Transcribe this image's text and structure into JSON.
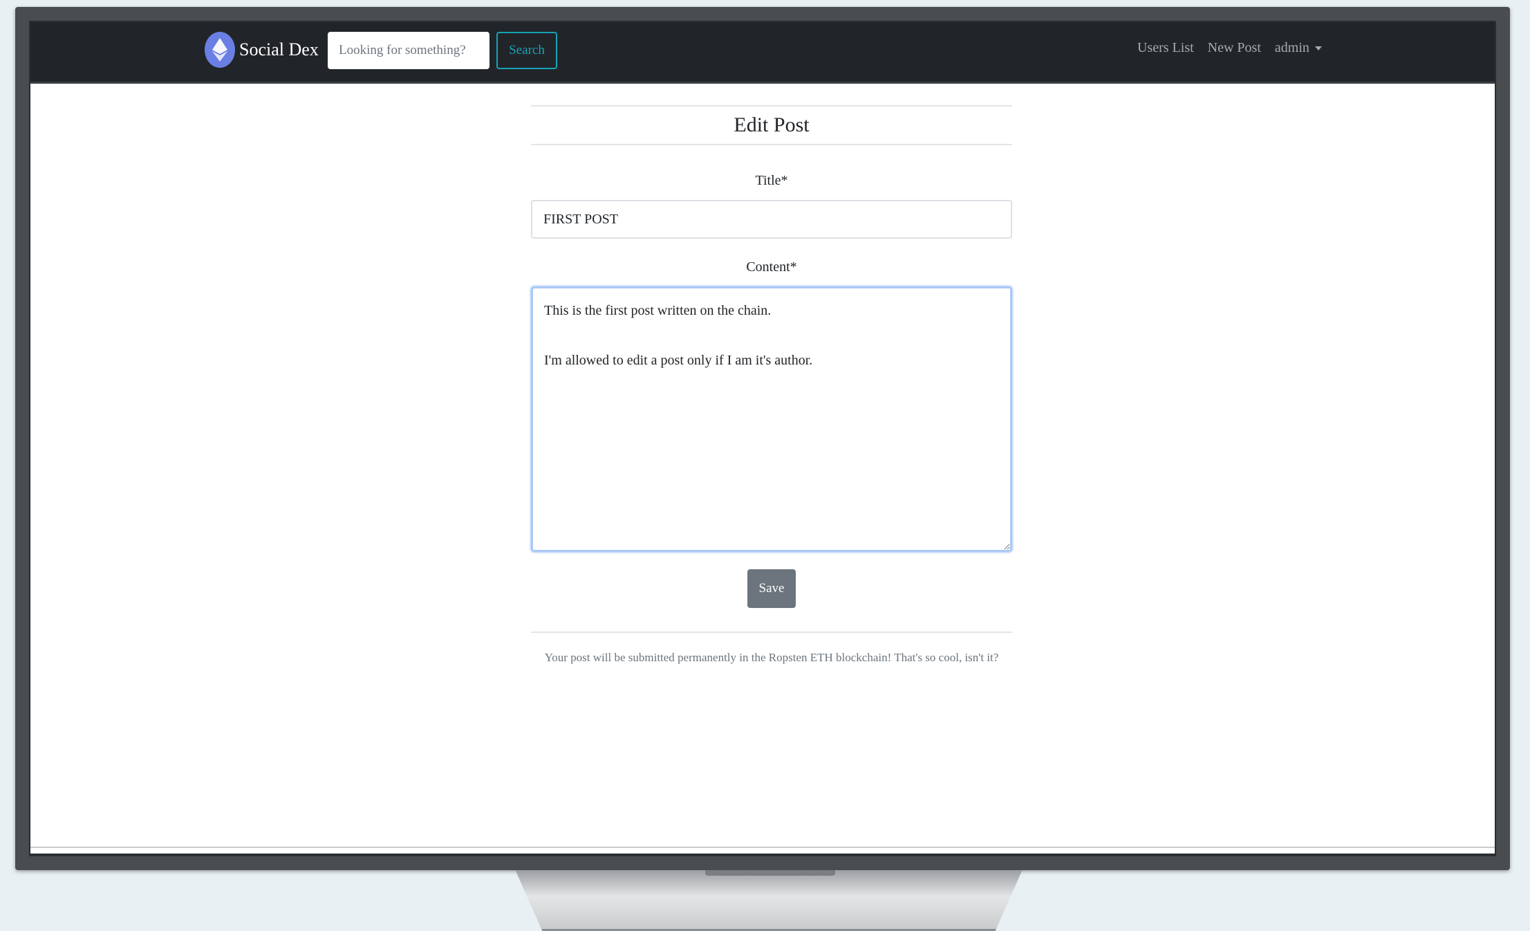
{
  "navbar": {
    "brand": "Social Dex",
    "search_placeholder": "Looking for something?",
    "search_button": "Search",
    "links": {
      "users_list": "Users List",
      "new_post": "New Post",
      "account": "admin"
    }
  },
  "form": {
    "heading": "Edit Post",
    "title_label": "Title*",
    "title_value": "FIRST POST",
    "content_label": "Content*",
    "content_value": "This is the first post written on the chain.\n\nI'm allowed to edit a post only if I am it's author.",
    "save_button": "Save",
    "footer_note": "Your post will be submitted permanently in the Ropsten ETH blockchain! That's so cool, isn't it?"
  },
  "colors": {
    "navbar_bg": "#212529",
    "search_accent": "#17a2b8",
    "save_button_bg": "#6c757d",
    "focus_border": "#a9c8f5"
  },
  "icons": {
    "brand_logo": "ethereum-diamond-icon",
    "account_menu": "caret-down-icon"
  }
}
